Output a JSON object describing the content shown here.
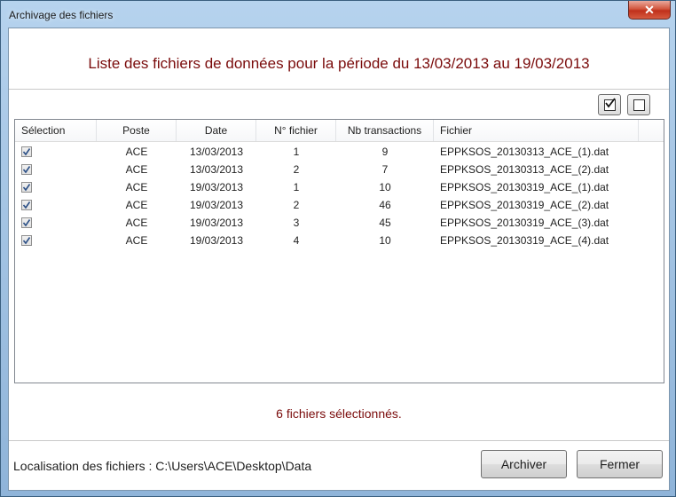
{
  "window": {
    "title": "Archivage des fichiers",
    "close_label": "✕"
  },
  "heading": "Liste des fichiers de données pour la période du 13/03/2013 au 19/03/2013",
  "toolbar": {
    "check_all_icon": "checkbox-checked-icon",
    "uncheck_all_icon": "checkbox-empty-icon"
  },
  "table": {
    "columns": [
      "Sélection",
      "Poste",
      "Date",
      "N° fichier",
      "Nb transactions",
      "Fichier"
    ],
    "rows": [
      {
        "selected": true,
        "poste": "ACE",
        "date": "13/03/2013",
        "num": "1",
        "nb": "9",
        "fichier": "EPPKSOS_20130313_ACE_(1).dat"
      },
      {
        "selected": true,
        "poste": "ACE",
        "date": "13/03/2013",
        "num": "2",
        "nb": "7",
        "fichier": "EPPKSOS_20130313_ACE_(2).dat"
      },
      {
        "selected": true,
        "poste": "ACE",
        "date": "19/03/2013",
        "num": "1",
        "nb": "10",
        "fichier": "EPPKSOS_20130319_ACE_(1).dat"
      },
      {
        "selected": true,
        "poste": "ACE",
        "date": "19/03/2013",
        "num": "2",
        "nb": "46",
        "fichier": "EPPKSOS_20130319_ACE_(2).dat"
      },
      {
        "selected": true,
        "poste": "ACE",
        "date": "19/03/2013",
        "num": "3",
        "nb": "45",
        "fichier": "EPPKSOS_20130319_ACE_(3).dat"
      },
      {
        "selected": true,
        "poste": "ACE",
        "date": "19/03/2013",
        "num": "4",
        "nb": "10",
        "fichier": "EPPKSOS_20130319_ACE_(4).dat"
      }
    ]
  },
  "status": "6 fichiers sélectionnés.",
  "location": "Localisation des fichiers : C:\\Users\\ACE\\Desktop\\Data",
  "buttons": {
    "archive": "Archiver",
    "close": "Fermer"
  },
  "colors": {
    "accent_text": "#7a0b0b",
    "title_bar": "#a9c8e6",
    "close_button": "#c0301b"
  }
}
